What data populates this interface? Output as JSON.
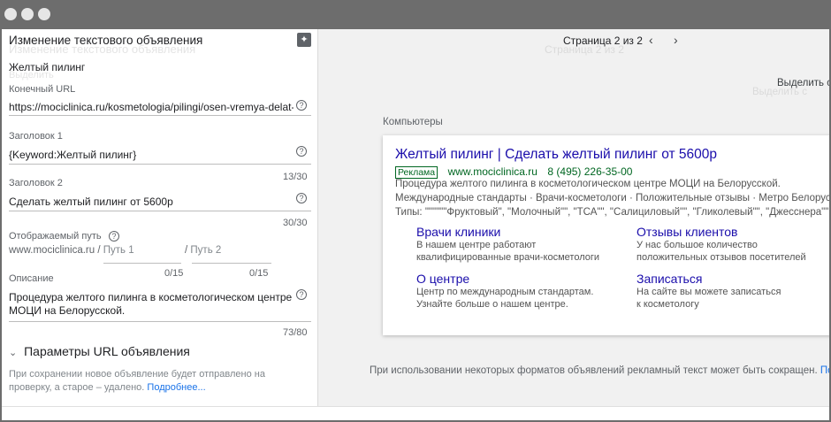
{
  "window": {
    "dots": 3
  },
  "editor": {
    "title": "Изменение текстового объявления",
    "ghost_title": "Изменение текстового объявления",
    "ad_name": "Желтый пилинг",
    "ghost_ad_name": "Выделить",
    "final_url_label": "Конечный URL",
    "final_url_value": "https://mociclinica.ru/kosmetologia/pilingi/osen-vremya-delat-p",
    "headline1_label": "Заголовок 1",
    "headline1_value": "{Keyword:Желтый пилинг}",
    "headline1_count": "13/30",
    "headline2_label": "Заголовок 2",
    "headline2_value": "Сделать желтый пилинг от 5600р",
    "headline2_count": "30/30",
    "path_label": "Отображаемый путь",
    "path_domain": "www.mociclinica.ru",
    "path_sep1": "/",
    "path1_placeholder": "Путь 1",
    "path_sep2": "/",
    "path2_placeholder": "Путь 2",
    "path1_count": "0/15",
    "path2_count": "0/15",
    "description_label": "Описание",
    "description_line1": "Процедура желтого пилинга в косметологическом центре",
    "description_line2": "МОЦИ на Белорусской.",
    "description_count": "73/80",
    "url_params_label": "Параметры URL объявления",
    "footer_note_line1": "При сохранении новое объявление будет отправлено на",
    "footer_note_line2": "проверку, а старое – удалено.",
    "footer_link": "Подробнее..."
  },
  "preview": {
    "page_indicator": "Страница 2 из 2",
    "ghost_page_indicator": "Страница 2 из 2",
    "select_label": "Выделить с",
    "ghost_select_label": "Выделить с",
    "device_label": "Компьютеры",
    "ad": {
      "headline": "Желтый пилинг | Сделать желтый пилинг от 5600р",
      "badge": "Реклама",
      "display_url": "www.mociclinica.ru",
      "phone": "8 (495) 226-35-00",
      "description": "Процедура желтого пилинга в косметологическом центре МОЦИ на Белорусской.",
      "callouts": "Международные стандарты · Врачи-косметологи · Положительные отзывы · Метро Белорусская",
      "snippet": "Типы: \"\"\"\"\"\"Фруктовый\", \"Молочный\"\", \"ТСА\"\", \"Салициловый\"\", \"Гликолевый\"\", \"Джесснера\"\", \"Миндальный\"",
      "sitelinks": [
        {
          "title": "Врачи клиники",
          "desc1": "В нашем центре работают",
          "desc2": "квалифицированные врачи-косметологи"
        },
        {
          "title": "Отзывы клиентов",
          "desc1": "У нас большое количество",
          "desc2": "положительных отзывов посетителей"
        },
        {
          "title": "О центре",
          "desc1": "Центр по международным стандартам.",
          "desc2": "Узнайте больше о нашем центре."
        },
        {
          "title": "Записаться",
          "desc1": "На сайте вы можете записаться",
          "desc2": "к косметологу"
        }
      ]
    },
    "disclaimer": "При использовании некоторых форматов объявлений рекламный текст может быть сокращен.",
    "disclaimer_link": "Подробнее"
  }
}
